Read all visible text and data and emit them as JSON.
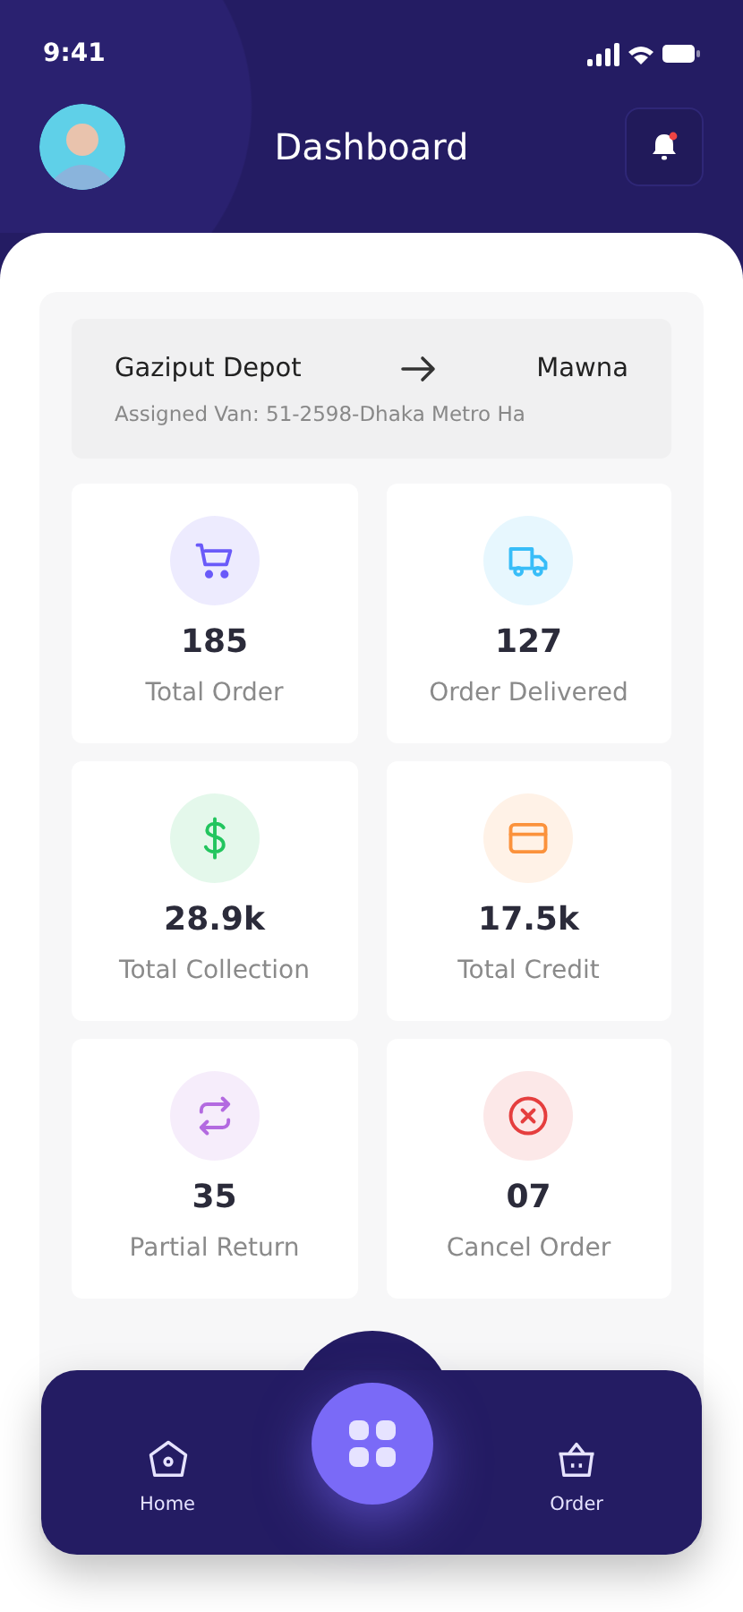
{
  "status_bar": {
    "time": "9:41"
  },
  "header": {
    "title": "Dashboard",
    "notification_dot": true
  },
  "route": {
    "from": "Gaziput Depot",
    "to": "Mawna",
    "van": "Assigned Van: 51-2598-Dhaka Metro Ha"
  },
  "stats": [
    {
      "kind": "cart",
      "value": "185",
      "label": "Total Order",
      "color": "#6a5af9"
    },
    {
      "kind": "truck",
      "value": "127",
      "label": "Order Delivered",
      "color": "#38bdf8"
    },
    {
      "kind": "dollar",
      "value": "28.9k",
      "label": "Total Collection",
      "color": "#22c55e"
    },
    {
      "kind": "card",
      "value": "17.5k",
      "label": "Total Credit",
      "color": "#fb923c"
    },
    {
      "kind": "repeat",
      "value": "35",
      "label": "Partial Return",
      "color": "#b36ae0"
    },
    {
      "kind": "cancel",
      "value": "07",
      "label": "Cancel Order",
      "color": "#e53e3e"
    }
  ],
  "nav": [
    {
      "kind": "home",
      "label": "Home"
    },
    {
      "kind": "order",
      "label": "Order"
    }
  ]
}
